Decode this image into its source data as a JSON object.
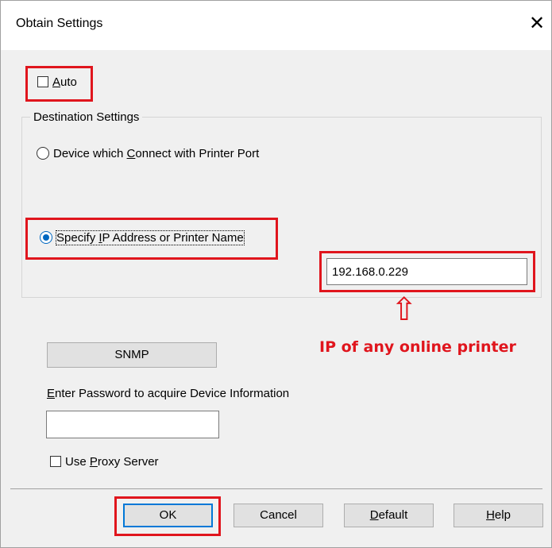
{
  "window": {
    "title": "Obtain Settings",
    "close_glyph": "✕"
  },
  "auto": {
    "label_first": "A",
    "label_rest": "uto",
    "checked": false
  },
  "destination": {
    "group_label": "Destination Settings",
    "option_port": {
      "pre": "Device which ",
      "u": "C",
      "post": "onnect with Printer Port",
      "selected": false
    },
    "option_ip": {
      "pre": "Specify ",
      "u": "I",
      "post": "P Address or Printer Name",
      "selected": true
    },
    "ip_value": "192.168.0.229"
  },
  "annotation": {
    "arrow_glyph": "⇧",
    "text": "IP of any online printer",
    "color": "#e0151d"
  },
  "snmp_button": "SNMP",
  "password": {
    "label_u": "E",
    "label_rest": "nter Password to acquire Device Information",
    "value": ""
  },
  "proxy": {
    "pre": "Use ",
    "u": "P",
    "post": "roxy Server",
    "checked": false
  },
  "buttons": {
    "ok": "OK",
    "cancel": "Cancel",
    "default_u": "D",
    "default_rest": "efault",
    "help_u": "H",
    "help_rest": "elp"
  },
  "icons": {
    "close": "close-icon",
    "arrow": "up-arrow-icon"
  }
}
